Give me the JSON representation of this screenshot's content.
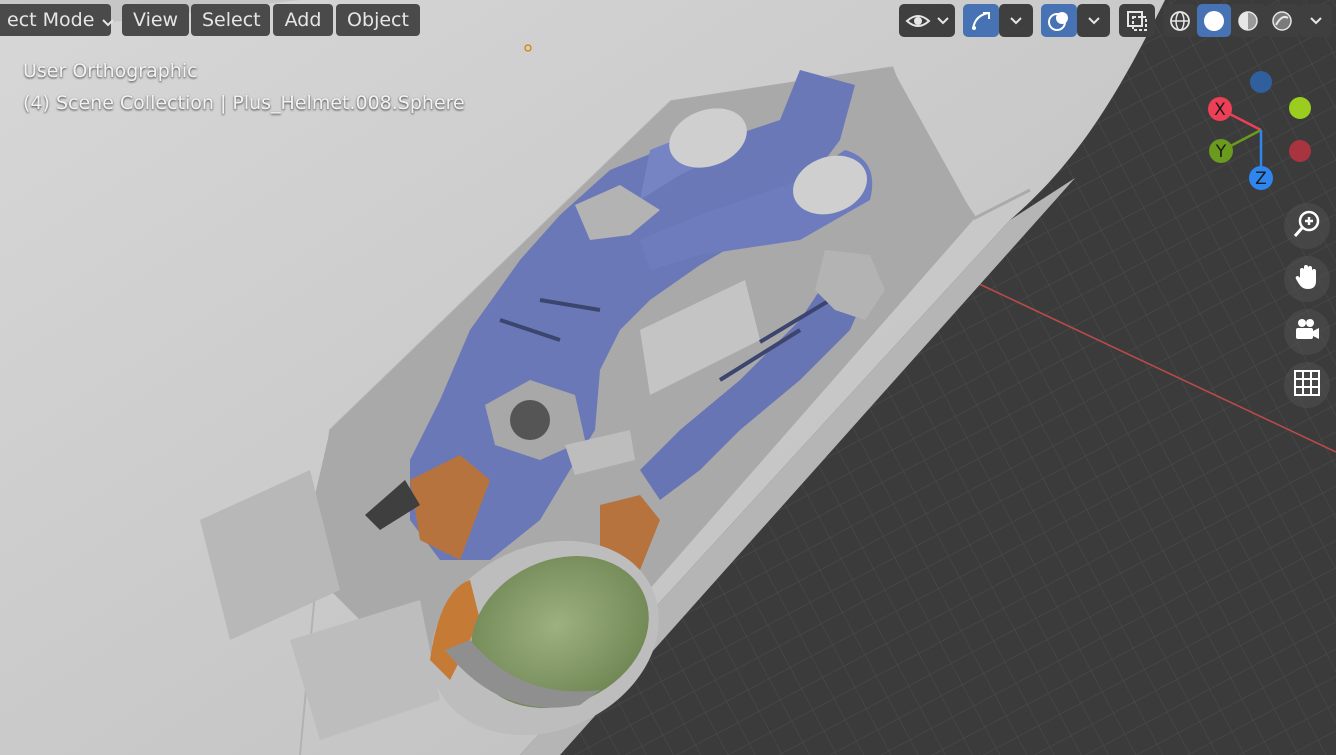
{
  "header": {
    "mode_label": "ect Mode",
    "menus": {
      "view": "View",
      "select": "Select",
      "add": "Add",
      "object": "Object"
    }
  },
  "viewport": {
    "view_name": "User Orthographic",
    "collection_info": "(4) Scene Collection | Plus_Helmet.008.Sphere"
  },
  "gizmo": {
    "x": "X",
    "y": "Y",
    "z": "Z"
  },
  "colors": {
    "axis_x": "#ed3f55",
    "axis_y": "#6a9a1e",
    "axis_z": "#2e86ee",
    "axis_neg_z": "#2f5f9c",
    "axis_neg_y": "#9acd1f",
    "axis_neg_x": "#a8343f",
    "accent": "#4772b3",
    "suit": "#6b78b8",
    "hull": "#c9c9c9"
  },
  "icons": {
    "visibility": "eye-icon",
    "gizmos": "gizmo-icon",
    "overlays": "overlay-icon",
    "xray": "xray-icon",
    "wireframe": "wireframe-shading-icon",
    "solid": "solid-shading-icon",
    "material": "material-preview-icon",
    "rendered": "rendered-shading-icon",
    "zoom": "zoom-icon",
    "pan": "hand-icon",
    "camera": "camera-icon",
    "grid": "grid-icon"
  }
}
